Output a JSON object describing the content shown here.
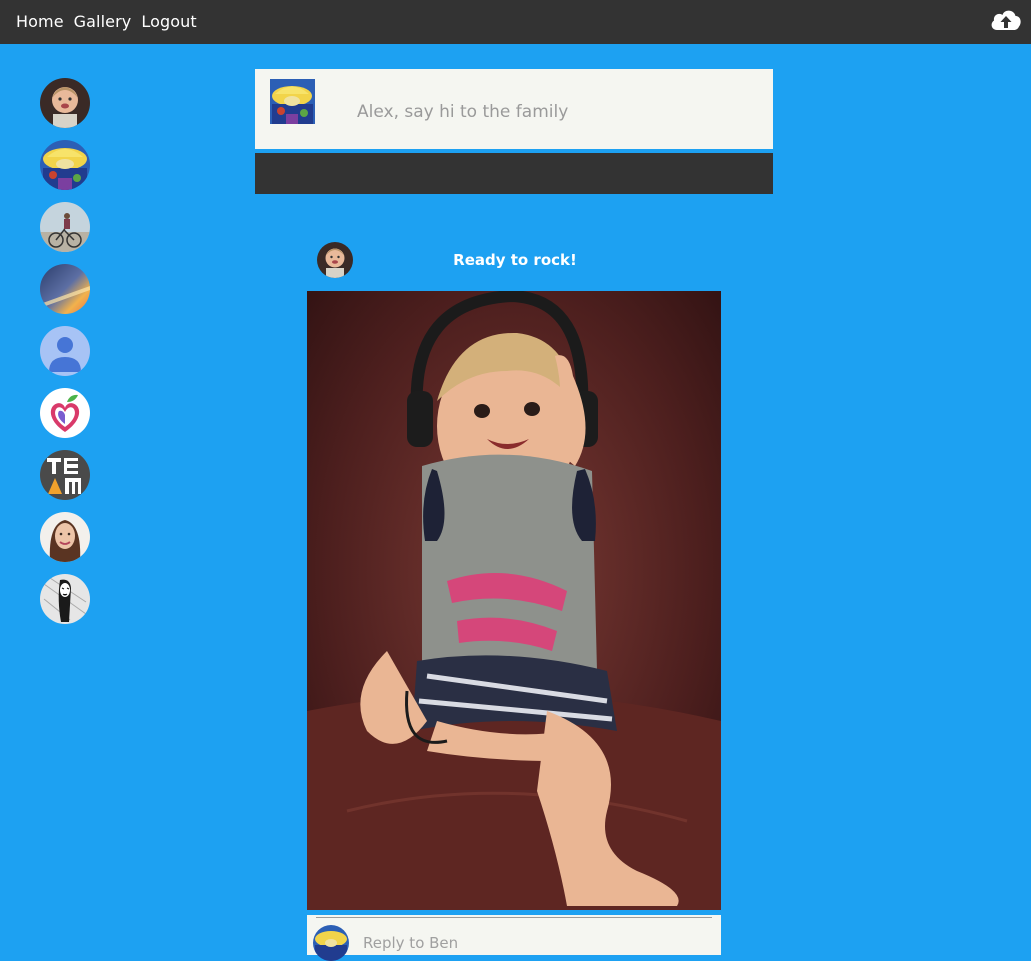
{
  "nav": {
    "home": "Home",
    "gallery": "Gallery",
    "logout": "Logout"
  },
  "upload_icon": "cloud-upload-icon",
  "sidebar": {
    "avatars": [
      {
        "name": "avatar-baby",
        "icon": "baby-photo"
      },
      {
        "name": "avatar-cartoon",
        "icon": "cartoon-character"
      },
      {
        "name": "avatar-bicycle",
        "icon": "bicycle-photo"
      },
      {
        "name": "avatar-sunset",
        "icon": "sunset-photo"
      },
      {
        "name": "avatar-default",
        "icon": "default-person-icon"
      },
      {
        "name": "avatar-heart-apple",
        "icon": "heart-apple-logo"
      },
      {
        "name": "avatar-team",
        "icon": "team-logo"
      },
      {
        "name": "avatar-woman",
        "icon": "woman-photo"
      },
      {
        "name": "avatar-sketch",
        "icon": "sketch-drawing"
      }
    ]
  },
  "composer": {
    "placeholder": "Alex, say hi to the family"
  },
  "post": {
    "caption": "Ready to rock!",
    "reply_placeholder": "Reply to Ben"
  },
  "colors": {
    "background": "#1da1f2",
    "topbar": "#333333",
    "panel": "#f5f6f1"
  }
}
